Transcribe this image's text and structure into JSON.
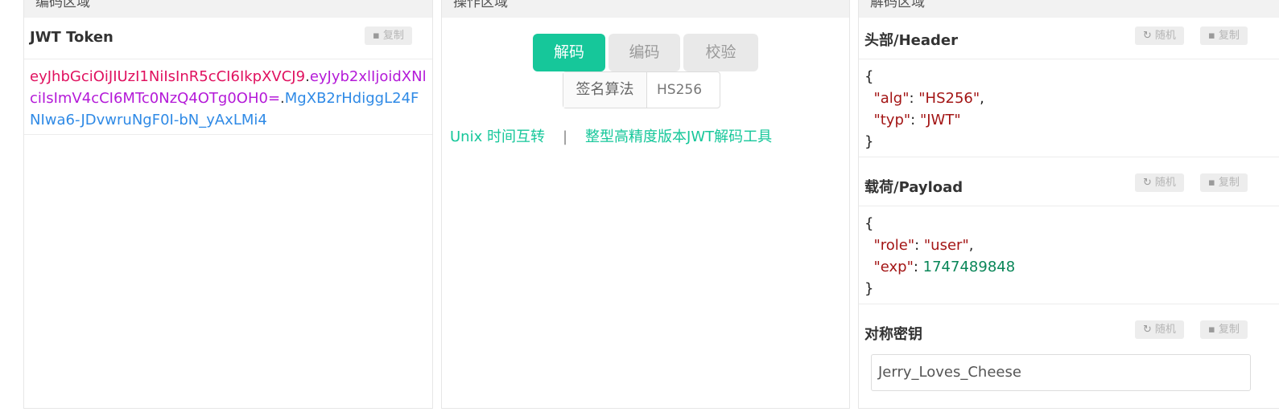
{
  "encode_panel": {
    "title": "编码区域",
    "section_title": "JWT Token",
    "copy_label": "复制",
    "token": {
      "header": "eyJhbGciOiJIUzI1NiIsInR5cCI6IkpXVCJ9",
      "dot1": ".",
      "payload": "eyJyb2xlIjoidXNlciIsImV4cCI6MTc0NzQ4OTg0OH0=",
      "dot2": ".",
      "signature": "MgXB2rHdiggL24FNIwa6-JDvwruNgF0I-bN_yAxLMi4"
    },
    "colors": {
      "header": "#e0115f",
      "payload": "#b41ad8",
      "signature": "#2f8ae6"
    }
  },
  "action_panel": {
    "title": "操作区域",
    "buttons": {
      "decode": "解码",
      "encode": "编码",
      "verify": "校验"
    },
    "algorithm": {
      "label": "签名算法",
      "value": "HS256"
    },
    "links": {
      "unix": "Unix 时间互转",
      "separator": "|",
      "precision": "整型高精度版本JWT解码工具"
    },
    "accent_color": "#16c79a"
  },
  "decode_panel": {
    "title": "解码区域",
    "random_label": "随机",
    "copy_label": "复制",
    "header": {
      "title": "头部/Header",
      "open": "{",
      "close": "}",
      "fields": [
        {
          "key": "\"alg\"",
          "colon": ": ",
          "value": "\"HS256\"",
          "comma": ","
        },
        {
          "key": "\"typ\"",
          "colon": ": ",
          "value": "\"JWT\"",
          "comma": ""
        }
      ]
    },
    "payload": {
      "title": "载荷/Payload",
      "open": "{",
      "close": "}",
      "fields": [
        {
          "key": "\"role\"",
          "colon": ": ",
          "value": "\"user\"",
          "comma": ","
        },
        {
          "key": "\"exp\"",
          "colon": ": ",
          "value": "1747489848",
          "comma": ""
        }
      ]
    },
    "secret": {
      "title": "对称密钥",
      "value": "Jerry_Loves_Cheese"
    }
  },
  "icons": {
    "copy": "clipboard-icon",
    "random": "refresh-icon"
  }
}
